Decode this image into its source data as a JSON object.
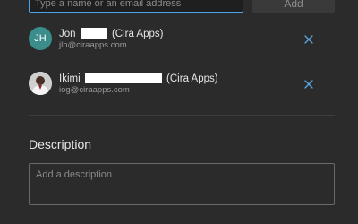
{
  "invite": {
    "placeholder": "Type a name or an email address",
    "add_label": "Add"
  },
  "members": [
    {
      "initials": "JH",
      "avatar_color": "#3b8d8c",
      "first_name": "Jon",
      "suffix": "(Cira Apps)",
      "email": "jlh@ciraapps.com",
      "avatar": "initials"
    },
    {
      "initials": "",
      "avatar_color": "#bcbcbc",
      "first_name": "Ikimi",
      "suffix": "(Cira Apps)",
      "email": "iog@ciraapps.com",
      "avatar": "photo"
    }
  ],
  "description": {
    "title": "Description",
    "placeholder": "Add a description"
  },
  "icons": {
    "remove": "close-icon",
    "photo": "user-photo-icon"
  },
  "colors": {
    "accent": "#4aa3e8",
    "background": "#2b2b2b"
  }
}
